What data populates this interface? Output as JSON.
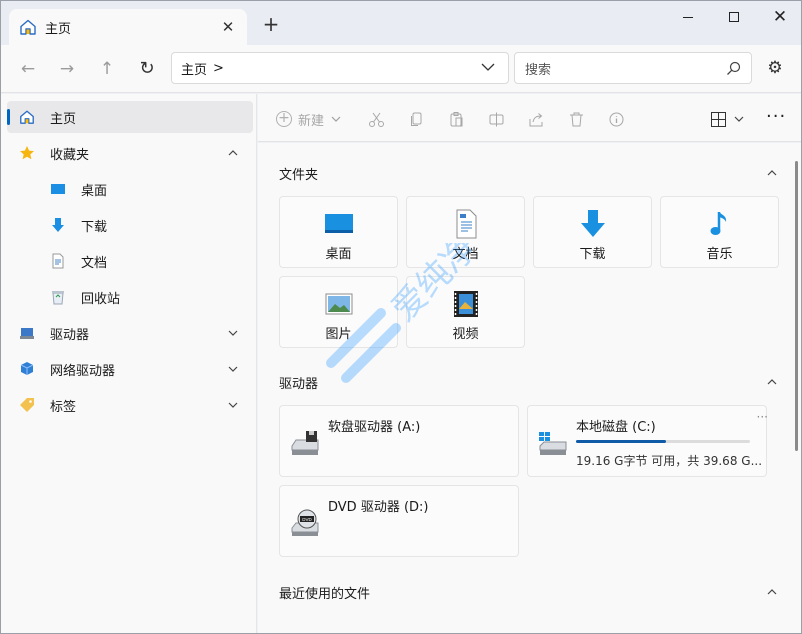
{
  "tab": {
    "title": "主页",
    "close": "✕",
    "new_tab": "+"
  },
  "window_controls": {
    "close": "✕"
  },
  "nav": {
    "back": "←",
    "forward": "→",
    "up": "↑",
    "refresh": "↻",
    "address_location": "主页",
    "address_separator": ">",
    "search_placeholder": "搜索",
    "settings": "⚙"
  },
  "sidebar": {
    "items": [
      {
        "label": "主页",
        "icon": "home-icon",
        "active": true
      },
      {
        "label": "收藏夹",
        "icon": "star-icon",
        "expand": "up"
      },
      {
        "label": "桌面",
        "icon": "desktop-icon",
        "sub": true
      },
      {
        "label": "下载",
        "icon": "download-icon",
        "sub": true
      },
      {
        "label": "文档",
        "icon": "document-icon",
        "sub": true
      },
      {
        "label": "回收站",
        "icon": "recycle-bin-icon",
        "sub": true
      },
      {
        "label": "驱动器",
        "icon": "drive-icon",
        "expand": "down"
      },
      {
        "label": "网络驱动器",
        "icon": "network-drive-icon",
        "expand": "down"
      },
      {
        "label": "标签",
        "icon": "tag-icon",
        "expand": "down"
      }
    ]
  },
  "commands": {
    "new_label": "新建",
    "more": "···",
    "icons": [
      "cut-icon",
      "copy-icon",
      "paste-icon",
      "rename-icon",
      "share-icon",
      "delete-icon",
      "info-icon",
      "layout-icon"
    ]
  },
  "sections": {
    "folders_title": "文件夹",
    "drives_title": "驱动器",
    "recent_title": "最近使用的文件"
  },
  "folders": [
    {
      "label": "桌面",
      "icon": "desktop-icon"
    },
    {
      "label": "文档",
      "icon": "document-icon"
    },
    {
      "label": "下载",
      "icon": "download-icon"
    },
    {
      "label": "音乐",
      "icon": "music-icon"
    },
    {
      "label": "图片",
      "icon": "pictures-icon"
    },
    {
      "label": "视频",
      "icon": "video-icon"
    }
  ],
  "drives": [
    {
      "name": "软盘驱动器 (A:)",
      "icon": "floppy-drive-icon"
    },
    {
      "name": "本地磁盘 (C:)",
      "icon": "local-disk-icon",
      "size_text": "19.16 G字节 可用，共 39.68 G...",
      "used_fraction": 0.517,
      "more": "···"
    },
    {
      "name": "DVD 驱动器 (D:)",
      "icon": "dvd-drive-icon"
    }
  ],
  "colors": {
    "accent": "#0067c0",
    "usage_bar": "#0f5ba8",
    "folder_blue": "#1a90e0"
  }
}
